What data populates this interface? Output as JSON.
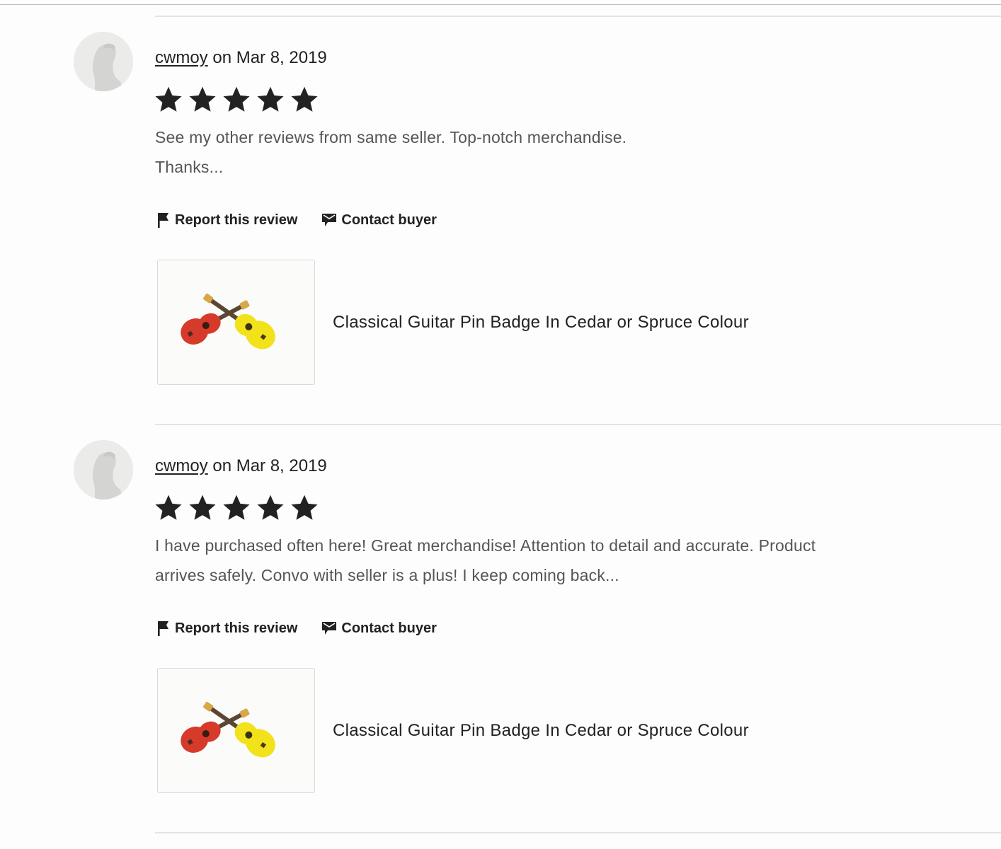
{
  "reviews": [
    {
      "username": "cwmoy",
      "date_text": "on Mar 8, 2019",
      "rating": 5,
      "text_lines": [
        "See my other reviews from same seller. Top-notch merchandise.",
        "Thanks..."
      ],
      "report_label": "Report this review",
      "contact_label": "Contact buyer",
      "listing_title": "Classical Guitar Pin Badge In Cedar or Spruce Colour"
    },
    {
      "username": "cwmoy",
      "date_text": "on Mar 8, 2019",
      "rating": 5,
      "text_lines": [
        "I have purchased often here! Great merchandise! Attention to detail and accurate. Product",
        "arrives safely. Convo with seller is a plus! I keep coming back..."
      ],
      "report_label": "Report this review",
      "contact_label": "Contact buyer",
      "listing_title": "Classical Guitar Pin Badge In Cedar or Spruce Colour"
    }
  ],
  "icons": {
    "avatar": "default-user-silhouette-icon",
    "star": "star-filled-icon",
    "report": "flag-icon",
    "contact": "message-bubble-icon"
  },
  "colors": {
    "text": "#222222",
    "review_text": "#555555",
    "divider": "#e4e4e4",
    "star": "#222222",
    "guitar_red": "#d63a2a",
    "guitar_yellow": "#f2e21a"
  }
}
